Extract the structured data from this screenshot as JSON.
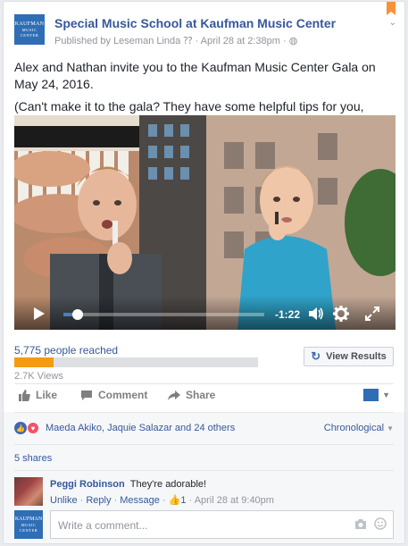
{
  "post": {
    "page_logo": {
      "line1": "KAUFMAN",
      "line2": "MUSIC",
      "line3": "CENTER"
    },
    "page_name": "Special Music School at Kaufman Music Center",
    "published_prefix": "Published by",
    "author": "Leseman Linda",
    "date_sep": "· April 28 at 2:38pm ·",
    "body_line1": "Alex and Nathan invite you to the Kaufman Music Center Gala on May 24, 2016.",
    "body_line2": "(Can't make it to the gala? They have some helpful tips for you, too!)"
  },
  "video": {
    "time_remaining": "-1:22",
    "progress": 0.07
  },
  "insights": {
    "reach_text": "5,775 people reached",
    "reach_fraction": 0.16,
    "view_results_label": "View Results",
    "views_text": "2.7K Views",
    "accent": "#f39c12"
  },
  "actions": {
    "like": "Like",
    "comment": "Comment",
    "share": "Share"
  },
  "reactions": {
    "names": "Maeda Akiko, Jaquie Salazar and 24 others",
    "order": "Chronological",
    "shares": "5 shares"
  },
  "comment": {
    "author": "Peggi Robinson",
    "text": "They're adorable!",
    "unlike": "Unlike",
    "reply": "Reply",
    "message": "Message",
    "like_count": "1",
    "timestamp": "April 28 at 9:40pm"
  },
  "composer": {
    "placeholder": "Write a comment..."
  }
}
